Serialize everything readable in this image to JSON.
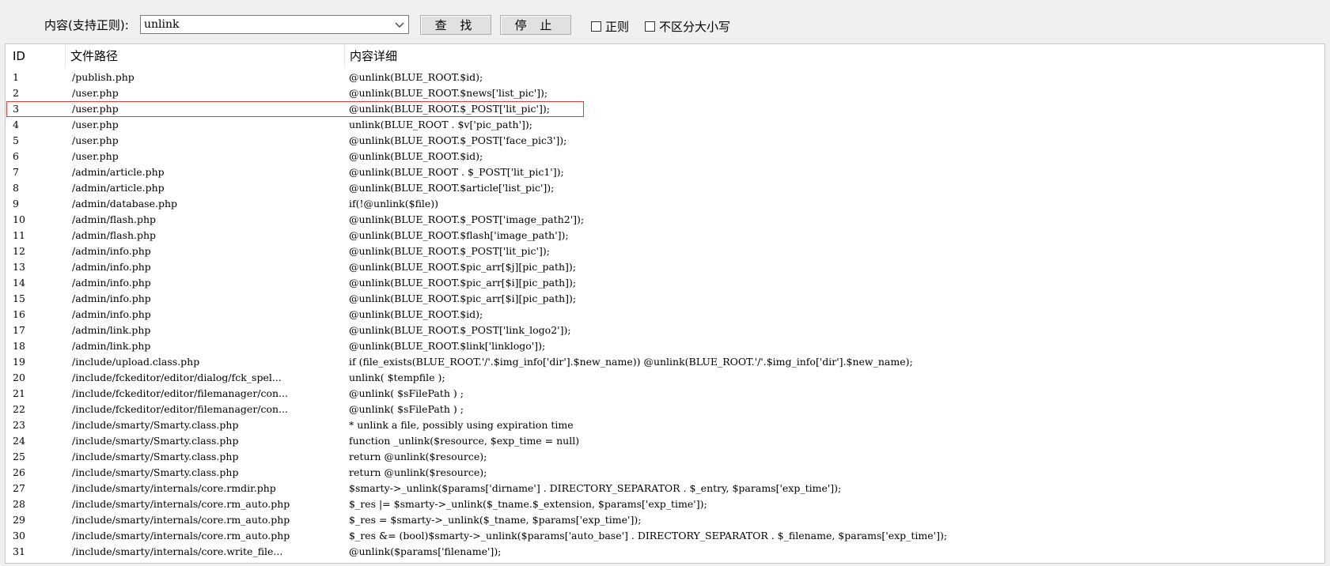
{
  "toolbar": {
    "search_label": "内容(支持正则):",
    "search_value": "unlink",
    "find_button": "查 找",
    "stop_button": "停 止",
    "regex_checkbox": "正则",
    "ignore_case_checkbox": "不区分大小写"
  },
  "table": {
    "columns": [
      "ID",
      "文件路径",
      "内容详细"
    ],
    "selected_row": 3,
    "rows": [
      {
        "id": "1",
        "path": "/publish.php",
        "detail": "@unlink(BLUE_ROOT.$id);"
      },
      {
        "id": "2",
        "path": "/user.php",
        "detail": "@unlink(BLUE_ROOT.$news['list_pic']);"
      },
      {
        "id": "3",
        "path": "/user.php",
        "detail": "@unlink(BLUE_ROOT.$_POST['lit_pic']);"
      },
      {
        "id": "4",
        "path": "/user.php",
        "detail": "unlink(BLUE_ROOT . $v['pic_path']);"
      },
      {
        "id": "5",
        "path": "/user.php",
        "detail": "@unlink(BLUE_ROOT.$_POST['face_pic3']);"
      },
      {
        "id": "6",
        "path": "/user.php",
        "detail": "@unlink(BLUE_ROOT.$id);"
      },
      {
        "id": "7",
        "path": "/admin/article.php",
        "detail": "@unlink(BLUE_ROOT . $_POST['lit_pic1']);"
      },
      {
        "id": "8",
        "path": "/admin/article.php",
        "detail": "@unlink(BLUE_ROOT.$article['list_pic']);"
      },
      {
        "id": "9",
        "path": "/admin/database.php",
        "detail": "if(!@unlink($file))"
      },
      {
        "id": "10",
        "path": "/admin/flash.php",
        "detail": "@unlink(BLUE_ROOT.$_POST['image_path2']);"
      },
      {
        "id": "11",
        "path": "/admin/flash.php",
        "detail": "@unlink(BLUE_ROOT.$flash['image_path']);"
      },
      {
        "id": "12",
        "path": "/admin/info.php",
        "detail": "@unlink(BLUE_ROOT.$_POST['lit_pic']);"
      },
      {
        "id": "13",
        "path": "/admin/info.php",
        "detail": "@unlink(BLUE_ROOT.$pic_arr[$j][pic_path]);"
      },
      {
        "id": "14",
        "path": "/admin/info.php",
        "detail": "@unlink(BLUE_ROOT.$pic_arr[$i][pic_path]);"
      },
      {
        "id": "15",
        "path": "/admin/info.php",
        "detail": "@unlink(BLUE_ROOT.$pic_arr[$i][pic_path]);"
      },
      {
        "id": "16",
        "path": "/admin/info.php",
        "detail": "@unlink(BLUE_ROOT.$id);"
      },
      {
        "id": "17",
        "path": "/admin/link.php",
        "detail": "@unlink(BLUE_ROOT.$_POST['link_logo2']);"
      },
      {
        "id": "18",
        "path": "/admin/link.php",
        "detail": "@unlink(BLUE_ROOT.$link['linklogo']);"
      },
      {
        "id": "19",
        "path": "/include/upload.class.php",
        "detail": "if (file_exists(BLUE_ROOT.'/'.$img_info['dir'].$new_name)) @unlink(BLUE_ROOT.'/'.$img_info['dir'].$new_name);"
      },
      {
        "id": "20",
        "path": "/include/fckeditor/editor/dialog/fck_spel...",
        "detail": "unlink( $tempfile );"
      },
      {
        "id": "21",
        "path": "/include/fckeditor/editor/filemanager/con...",
        "detail": "@unlink( $sFilePath ) ;"
      },
      {
        "id": "22",
        "path": "/include/fckeditor/editor/filemanager/con...",
        "detail": "@unlink( $sFilePath ) ;"
      },
      {
        "id": "23",
        "path": "/include/smarty/Smarty.class.php",
        "detail": "* unlink a file, possibly using expiration time"
      },
      {
        "id": "24",
        "path": "/include/smarty/Smarty.class.php",
        "detail": "function _unlink($resource, $exp_time = null)"
      },
      {
        "id": "25",
        "path": "/include/smarty/Smarty.class.php",
        "detail": "return @unlink($resource);"
      },
      {
        "id": "26",
        "path": "/include/smarty/Smarty.class.php",
        "detail": "return @unlink($resource);"
      },
      {
        "id": "27",
        "path": "/include/smarty/internals/core.rmdir.php",
        "detail": "$smarty->_unlink($params['dirname'] . DIRECTORY_SEPARATOR . $_entry, $params['exp_time']);"
      },
      {
        "id": "28",
        "path": "/include/smarty/internals/core.rm_auto.php",
        "detail": "$_res |= $smarty->_unlink($_tname.$_extension, $params['exp_time']);"
      },
      {
        "id": "29",
        "path": "/include/smarty/internals/core.rm_auto.php",
        "detail": "$_res = $smarty->_unlink($_tname, $params['exp_time']);"
      },
      {
        "id": "30",
        "path": "/include/smarty/internals/core.rm_auto.php",
        "detail": "$_res &= (bool)$smarty->_unlink($params['auto_base'] . DIRECTORY_SEPARATOR . $_filename, $params['exp_time']);"
      },
      {
        "id": "31",
        "path": "/include/smarty/internals/core.write_file...",
        "detail": "@unlink($params['filename']);"
      }
    ]
  }
}
